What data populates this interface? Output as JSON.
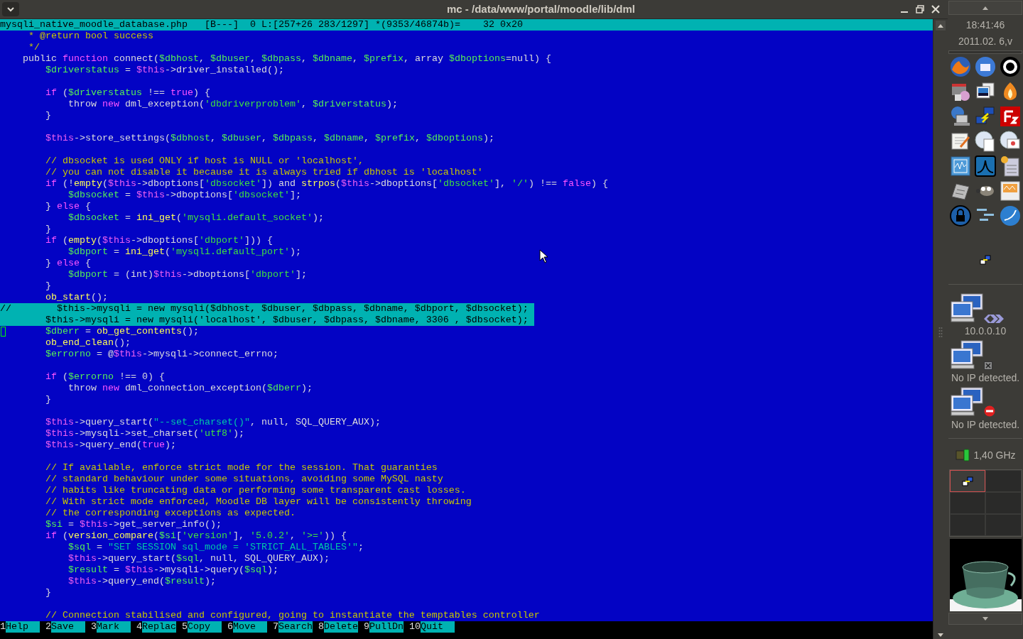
{
  "window": {
    "title": "mc - /data/www/portal/moodle/lib/dml"
  },
  "editor": {
    "status": {
      "file": "mysqli_native_moodle_database.php",
      "flags": "[B---]",
      "position": "0 L:[257+26 283/1297]",
      "size": "*(9353/46874b)=",
      "char": "32 0x20"
    },
    "lines": [
      {
        "selected": false,
        "cursor": false,
        "tokens": [
          {
            "kind": "comment",
            "text": "     * @return bool success"
          }
        ]
      },
      {
        "selected": false,
        "cursor": false,
        "tokens": [
          {
            "kind": "comment",
            "text": "     */"
          }
        ]
      },
      {
        "selected": false,
        "cursor": false,
        "tokens": [
          {
            "kind": "plain",
            "text": "    public "
          },
          {
            "kind": "keyword",
            "text": "function"
          },
          {
            "kind": "plain",
            "text": " connect("
          },
          {
            "kind": "var",
            "text": "$dbhost"
          },
          {
            "kind": "plain",
            "text": ", "
          },
          {
            "kind": "var",
            "text": "$dbuser"
          },
          {
            "kind": "plain",
            "text": ", "
          },
          {
            "kind": "var",
            "text": "$dbpass"
          },
          {
            "kind": "plain",
            "text": ", "
          },
          {
            "kind": "var",
            "text": "$dbname"
          },
          {
            "kind": "plain",
            "text": ", "
          },
          {
            "kind": "var",
            "text": "$prefix"
          },
          {
            "kind": "plain",
            "text": ", array "
          },
          {
            "kind": "var",
            "text": "$dboptions"
          },
          {
            "kind": "plain",
            "text": "=null) {"
          }
        ]
      },
      {
        "selected": false,
        "cursor": false,
        "tokens": [
          {
            "kind": "var",
            "text": "        $driverstatus"
          },
          {
            "kind": "plain",
            "text": " = "
          },
          {
            "kind": "this",
            "text": "$this"
          },
          {
            "kind": "plain",
            "text": "->driver_installed();"
          }
        ]
      },
      {
        "selected": false,
        "cursor": false
      },
      {
        "selected": false,
        "cursor": false,
        "tokens": [
          {
            "kind": "keyword",
            "text": "        if"
          },
          {
            "kind": "plain",
            "text": " ("
          },
          {
            "kind": "var",
            "text": "$driverstatus"
          },
          {
            "kind": "plain",
            "text": " !== "
          },
          {
            "kind": "keyword",
            "text": "true"
          },
          {
            "kind": "plain",
            "text": ") {"
          }
        ]
      },
      {
        "selected": false,
        "cursor": false,
        "tokens": [
          {
            "kind": "plain",
            "text": "            throw "
          },
          {
            "kind": "keyword",
            "text": "new"
          },
          {
            "kind": "plain",
            "text": " dml_exception("
          },
          {
            "kind": "str",
            "text": "'dbdriverproblem'"
          },
          {
            "kind": "plain",
            "text": ", "
          },
          {
            "kind": "var",
            "text": "$driverstatus"
          },
          {
            "kind": "plain",
            "text": ");"
          }
        ]
      },
      {
        "selected": false,
        "cursor": false,
        "tokens": [
          {
            "kind": "plain",
            "text": "        }"
          }
        ]
      },
      {
        "selected": false,
        "cursor": false
      },
      {
        "selected": false,
        "cursor": false,
        "tokens": [
          {
            "kind": "this",
            "text": "        $this"
          },
          {
            "kind": "plain",
            "text": "->store_settings("
          },
          {
            "kind": "var",
            "text": "$dbhost"
          },
          {
            "kind": "plain",
            "text": ", "
          },
          {
            "kind": "var",
            "text": "$dbuser"
          },
          {
            "kind": "plain",
            "text": ", "
          },
          {
            "kind": "var",
            "text": "$dbpass"
          },
          {
            "kind": "plain",
            "text": ", "
          },
          {
            "kind": "var",
            "text": "$dbname"
          },
          {
            "kind": "plain",
            "text": ", "
          },
          {
            "kind": "var",
            "text": "$prefix"
          },
          {
            "kind": "plain",
            "text": ", "
          },
          {
            "kind": "var",
            "text": "$dboptions"
          },
          {
            "kind": "plain",
            "text": ");"
          }
        ]
      },
      {
        "selected": false,
        "cursor": false
      },
      {
        "selected": false,
        "cursor": false,
        "tokens": [
          {
            "kind": "comment",
            "text": "        // dbsocket is used ONLY if host is NULL or 'localhost',"
          }
        ]
      },
      {
        "selected": false,
        "cursor": false,
        "tokens": [
          {
            "kind": "comment",
            "text": "        // you can not disable it because it is always tried if dbhost is 'localhost'"
          }
        ]
      },
      {
        "selected": false,
        "cursor": false,
        "tokens": [
          {
            "kind": "keyword",
            "text": "        if"
          },
          {
            "kind": "plain",
            "text": " (!"
          },
          {
            "kind": "func",
            "text": "empty"
          },
          {
            "kind": "plain",
            "text": "("
          },
          {
            "kind": "this",
            "text": "$this"
          },
          {
            "kind": "plain",
            "text": "->dboptions["
          },
          {
            "kind": "str",
            "text": "'dbsocket'"
          },
          {
            "kind": "plain",
            "text": "]) and "
          },
          {
            "kind": "func",
            "text": "strpos"
          },
          {
            "kind": "plain",
            "text": "("
          },
          {
            "kind": "this",
            "text": "$this"
          },
          {
            "kind": "plain",
            "text": "->dboptions["
          },
          {
            "kind": "str",
            "text": "'dbsocket'"
          },
          {
            "kind": "plain",
            "text": "], "
          },
          {
            "kind": "str",
            "text": "'/'"
          },
          {
            "kind": "plain",
            "text": ") !== "
          },
          {
            "kind": "keyword",
            "text": "false"
          },
          {
            "kind": "plain",
            "text": ") {"
          }
        ]
      },
      {
        "selected": false,
        "cursor": false,
        "tokens": [
          {
            "kind": "var",
            "text": "            $dbsocket"
          },
          {
            "kind": "plain",
            "text": " = "
          },
          {
            "kind": "this",
            "text": "$this"
          },
          {
            "kind": "plain",
            "text": "->dboptions["
          },
          {
            "kind": "str",
            "text": "'dbsocket'"
          },
          {
            "kind": "plain",
            "text": "];"
          }
        ]
      },
      {
        "selected": false,
        "cursor": false,
        "tokens": [
          {
            "kind": "plain",
            "text": "        } "
          },
          {
            "kind": "keyword",
            "text": "else"
          },
          {
            "kind": "plain",
            "text": " {"
          }
        ]
      },
      {
        "selected": false,
        "cursor": false,
        "tokens": [
          {
            "kind": "var",
            "text": "            $dbsocket"
          },
          {
            "kind": "plain",
            "text": " = "
          },
          {
            "kind": "func",
            "text": "ini_get"
          },
          {
            "kind": "plain",
            "text": "("
          },
          {
            "kind": "str",
            "text": "'mysqli.default_socket'"
          },
          {
            "kind": "plain",
            "text": ");"
          }
        ]
      },
      {
        "selected": false,
        "cursor": false,
        "tokens": [
          {
            "kind": "plain",
            "text": "        }"
          }
        ]
      },
      {
        "selected": false,
        "cursor": false,
        "tokens": [
          {
            "kind": "keyword",
            "text": "        if"
          },
          {
            "kind": "plain",
            "text": " ("
          },
          {
            "kind": "func",
            "text": "empty"
          },
          {
            "kind": "plain",
            "text": "("
          },
          {
            "kind": "this",
            "text": "$this"
          },
          {
            "kind": "plain",
            "text": "->dboptions["
          },
          {
            "kind": "str",
            "text": "'dbport'"
          },
          {
            "kind": "plain",
            "text": "])) {"
          }
        ]
      },
      {
        "selected": false,
        "cursor": false,
        "tokens": [
          {
            "kind": "var",
            "text": "            $dbport"
          },
          {
            "kind": "plain",
            "text": " = "
          },
          {
            "kind": "func",
            "text": "ini_get"
          },
          {
            "kind": "plain",
            "text": "("
          },
          {
            "kind": "str",
            "text": "'mysqli.default_port'"
          },
          {
            "kind": "plain",
            "text": ");"
          }
        ]
      },
      {
        "selected": false,
        "cursor": false,
        "tokens": [
          {
            "kind": "plain",
            "text": "        } "
          },
          {
            "kind": "keyword",
            "text": "else"
          },
          {
            "kind": "plain",
            "text": " {"
          }
        ]
      },
      {
        "selected": false,
        "cursor": false,
        "tokens": [
          {
            "kind": "var",
            "text": "            $dbport"
          },
          {
            "kind": "plain",
            "text": " = (int)"
          },
          {
            "kind": "this",
            "text": "$this"
          },
          {
            "kind": "plain",
            "text": "->dboptions["
          },
          {
            "kind": "str",
            "text": "'dbport'"
          },
          {
            "kind": "plain",
            "text": "];"
          }
        ]
      },
      {
        "selected": false,
        "cursor": false,
        "tokens": [
          {
            "kind": "plain",
            "text": "        }"
          }
        ]
      },
      {
        "selected": false,
        "cursor": false,
        "tokens": [
          {
            "kind": "func",
            "text": "        ob_start"
          },
          {
            "kind": "plain",
            "text": "();"
          }
        ]
      },
      {
        "selected": true,
        "cursor": false,
        "tokens": [
          {
            "kind": "plain",
            "text": "//        $this->mysqli = new mysqli($dbhost, $dbuser, $dbpass, $dbname, $dbport, $dbsocket);"
          }
        ]
      },
      {
        "selected": true,
        "cursor": false,
        "tokens": [
          {
            "kind": "plain",
            "text": "        $this->mysqli = new mysqli('localhost', $dbuser, $dbpass, $dbname, 3306 , $dbsocket);"
          }
        ]
      },
      {
        "selected": false,
        "cursor": true,
        "tokens": [
          {
            "kind": "var",
            "text": "        $dberr"
          },
          {
            "kind": "plain",
            "text": " = "
          },
          {
            "kind": "func",
            "text": "ob_get_contents"
          },
          {
            "kind": "plain",
            "text": "();"
          }
        ]
      },
      {
        "selected": false,
        "cursor": false,
        "tokens": [
          {
            "kind": "func",
            "text": "        ob_end_clean"
          },
          {
            "kind": "plain",
            "text": "();"
          }
        ]
      },
      {
        "selected": false,
        "cursor": false,
        "tokens": [
          {
            "kind": "var",
            "text": "        $errorno"
          },
          {
            "kind": "plain",
            "text": " = @"
          },
          {
            "kind": "this",
            "text": "$this"
          },
          {
            "kind": "plain",
            "text": "->mysqli->connect_errno;"
          }
        ]
      },
      {
        "selected": false,
        "cursor": false
      },
      {
        "selected": false,
        "cursor": false,
        "tokens": [
          {
            "kind": "keyword",
            "text": "        if"
          },
          {
            "kind": "plain",
            "text": " ("
          },
          {
            "kind": "var",
            "text": "$errorno"
          },
          {
            "kind": "plain",
            "text": " !== 0) {"
          }
        ]
      },
      {
        "selected": false,
        "cursor": false,
        "tokens": [
          {
            "kind": "plain",
            "text": "            throw "
          },
          {
            "kind": "keyword",
            "text": "new"
          },
          {
            "kind": "plain",
            "text": " dml_connection_exception("
          },
          {
            "kind": "var",
            "text": "$dberr"
          },
          {
            "kind": "plain",
            "text": ");"
          }
        ]
      },
      {
        "selected": false,
        "cursor": false,
        "tokens": [
          {
            "kind": "plain",
            "text": "        }"
          }
        ]
      },
      {
        "selected": false,
        "cursor": false
      },
      {
        "selected": false,
        "cursor": false,
        "tokens": [
          {
            "kind": "this",
            "text": "        $this"
          },
          {
            "kind": "plain",
            "text": "->query_start("
          },
          {
            "kind": "dstr",
            "text": "\"--set_charset()\""
          },
          {
            "kind": "plain",
            "text": ", null, SQL_QUERY_AUX);"
          }
        ]
      },
      {
        "selected": false,
        "cursor": false,
        "tokens": [
          {
            "kind": "this",
            "text": "        $this"
          },
          {
            "kind": "plain",
            "text": "->mysqli->set_charset("
          },
          {
            "kind": "str",
            "text": "'utf8'"
          },
          {
            "kind": "plain",
            "text": ");"
          }
        ]
      },
      {
        "selected": false,
        "cursor": false,
        "tokens": [
          {
            "kind": "this",
            "text": "        $this"
          },
          {
            "kind": "plain",
            "text": "->query_end("
          },
          {
            "kind": "keyword",
            "text": "true"
          },
          {
            "kind": "plain",
            "text": ");"
          }
        ]
      },
      {
        "selected": false,
        "cursor": false
      },
      {
        "selected": false,
        "cursor": false,
        "tokens": [
          {
            "kind": "comment",
            "text": "        // If available, enforce strict mode for the session. That guaranties"
          }
        ]
      },
      {
        "selected": false,
        "cursor": false,
        "tokens": [
          {
            "kind": "comment",
            "text": "        // standard behaviour under some situations, avoiding some MySQL nasty"
          }
        ]
      },
      {
        "selected": false,
        "cursor": false,
        "tokens": [
          {
            "kind": "comment",
            "text": "        // habits like truncating data or performing some transparent cast losses."
          }
        ]
      },
      {
        "selected": false,
        "cursor": false,
        "tokens": [
          {
            "kind": "comment",
            "text": "        // With strict mode enforced, Moodle DB layer will be consistently throwing"
          }
        ]
      },
      {
        "selected": false,
        "cursor": false,
        "tokens": [
          {
            "kind": "comment",
            "text": "        // the corresponding exceptions as expected."
          }
        ]
      },
      {
        "selected": false,
        "cursor": false,
        "tokens": [
          {
            "kind": "var",
            "text": "        $si"
          },
          {
            "kind": "plain",
            "text": " = "
          },
          {
            "kind": "this",
            "text": "$this"
          },
          {
            "kind": "plain",
            "text": "->get_server_info();"
          }
        ]
      },
      {
        "selected": false,
        "cursor": false,
        "tokens": [
          {
            "kind": "keyword",
            "text": "        if"
          },
          {
            "kind": "plain",
            "text": " ("
          },
          {
            "kind": "func",
            "text": "version_compare"
          },
          {
            "kind": "plain",
            "text": "("
          },
          {
            "kind": "var",
            "text": "$si"
          },
          {
            "kind": "plain",
            "text": "["
          },
          {
            "kind": "str",
            "text": "'version'"
          },
          {
            "kind": "plain",
            "text": "], "
          },
          {
            "kind": "str",
            "text": "'5.0.2'"
          },
          {
            "kind": "plain",
            "text": ", "
          },
          {
            "kind": "str",
            "text": "'>='"
          },
          {
            "kind": "plain",
            "text": ")) {"
          }
        ]
      },
      {
        "selected": false,
        "cursor": false,
        "tokens": [
          {
            "kind": "var",
            "text": "            $sql"
          },
          {
            "kind": "plain",
            "text": " = "
          },
          {
            "kind": "dstr",
            "text": "\"SET SESSION sql_mode = 'STRICT_ALL_TABLES'\""
          },
          {
            "kind": "plain",
            "text": ";"
          }
        ]
      },
      {
        "selected": false,
        "cursor": false,
        "tokens": [
          {
            "kind": "this",
            "text": "            $this"
          },
          {
            "kind": "plain",
            "text": "->query_start("
          },
          {
            "kind": "var",
            "text": "$sql"
          },
          {
            "kind": "plain",
            "text": ", null, SQL_QUERY_AUX);"
          }
        ]
      },
      {
        "selected": false,
        "cursor": false,
        "tokens": [
          {
            "kind": "var",
            "text": "            $result"
          },
          {
            "kind": "plain",
            "text": " = "
          },
          {
            "kind": "this",
            "text": "$this"
          },
          {
            "kind": "plain",
            "text": "->mysqli->query("
          },
          {
            "kind": "var",
            "text": "$sql"
          },
          {
            "kind": "plain",
            "text": ");"
          }
        ]
      },
      {
        "selected": false,
        "cursor": false,
        "tokens": [
          {
            "kind": "this",
            "text": "            $this"
          },
          {
            "kind": "plain",
            "text": "->query_end("
          },
          {
            "kind": "var",
            "text": "$result"
          },
          {
            "kind": "plain",
            "text": ");"
          }
        ]
      },
      {
        "selected": false,
        "cursor": false,
        "tokens": [
          {
            "kind": "plain",
            "text": "        }"
          }
        ]
      },
      {
        "selected": false,
        "cursor": false
      },
      {
        "selected": false,
        "cursor": false,
        "tokens": [
          {
            "kind": "comment",
            "text": "        // Connection stabilised and configured, going to instantiate the temptables controller"
          }
        ]
      }
    ]
  },
  "function_keys": [
    {
      "number": "1",
      "label": "Help"
    },
    {
      "number": "2",
      "label": "Save"
    },
    {
      "number": "3",
      "label": "Mark"
    },
    {
      "number": "4",
      "label": "Replac"
    },
    {
      "number": "5",
      "label": "Copy"
    },
    {
      "number": "6",
      "label": "Move"
    },
    {
      "number": "7",
      "label": "Search"
    },
    {
      "number": "8",
      "label": "Delete"
    },
    {
      "number": "9",
      "label": "PullDn"
    },
    {
      "number": "10",
      "label": "Quit"
    }
  ],
  "panel": {
    "clock": {
      "time": "18:41:46",
      "date": "2011.02. 6,v"
    },
    "network": [
      {
        "kind": "connected",
        "address": "10.0.0.10"
      },
      {
        "kind": "unplugged",
        "address": "No IP detected."
      },
      {
        "kind": "blocked",
        "address": "No IP detected."
      }
    ],
    "cpu": {
      "frequency": "1,40 GHz"
    },
    "workspaces": [
      {
        "selected": true
      },
      {
        "selected": false
      },
      {
        "selected": false
      },
      {
        "selected": false
      },
      {
        "selected": false
      },
      {
        "selected": false
      }
    ]
  }
}
